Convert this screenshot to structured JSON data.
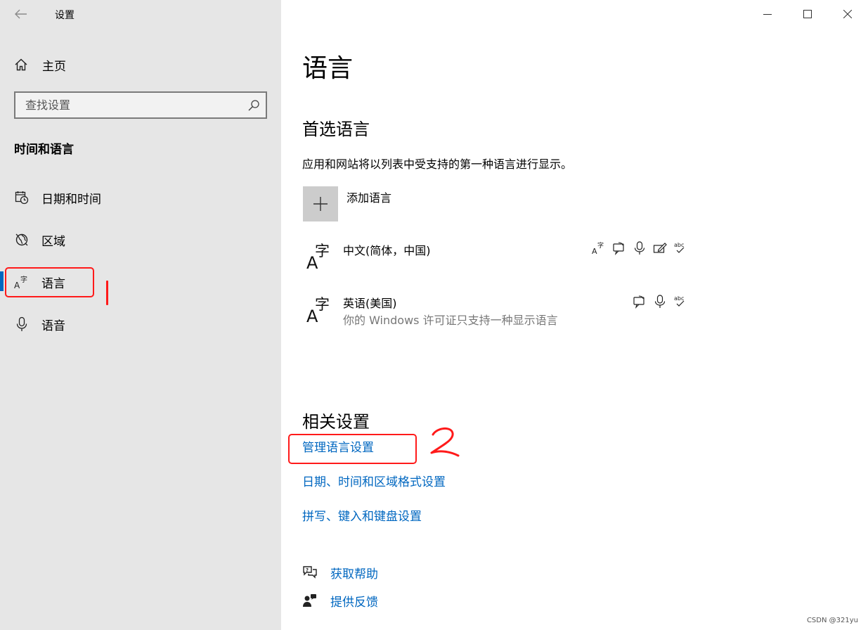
{
  "window": {
    "app_title": "设置"
  },
  "sidebar": {
    "home_label": "主页",
    "search": {
      "placeholder": "查找设置"
    },
    "section_title": "时间和语言",
    "items": [
      {
        "id": "date-time",
        "label": "日期和时间",
        "icon": "calendar-clock-icon"
      },
      {
        "id": "region",
        "label": "区域",
        "icon": "globe-icon"
      },
      {
        "id": "language",
        "label": "语言",
        "icon": "language-icon",
        "selected": true
      },
      {
        "id": "speech",
        "label": "语音",
        "icon": "microphone-icon"
      }
    ]
  },
  "main": {
    "title": "语言",
    "preferred": {
      "heading": "首选语言",
      "description": "应用和网站将以列表中受支持的第一种语言进行显示。",
      "add_label": "添加语言",
      "languages": [
        {
          "name": "中文(简体，中国)",
          "note": "",
          "features": [
            "display-language-icon",
            "speech-bubble-icon",
            "microphone-icon",
            "handwriting-icon",
            "spellcheck-icon"
          ]
        },
        {
          "name": "英语(美国)",
          "note": "你的 Windows 许可证只支持一种显示语言",
          "features": [
            "speech-bubble-icon",
            "microphone-icon",
            "spellcheck-icon"
          ]
        }
      ]
    },
    "related": {
      "heading": "相关设置",
      "links": [
        "管理语言设置",
        "日期、时间和区域格式设置",
        "拼写、键入和键盘设置"
      ]
    },
    "help": {
      "get_help": "获取帮助",
      "feedback": "提供反馈"
    }
  },
  "annotations": {
    "marker_2": "2"
  },
  "watermark": "CSDN @321yu",
  "colors": {
    "accent": "#0067c0",
    "sidebar_bg": "#e6e6e6",
    "annotation": "#ff1a1a"
  }
}
